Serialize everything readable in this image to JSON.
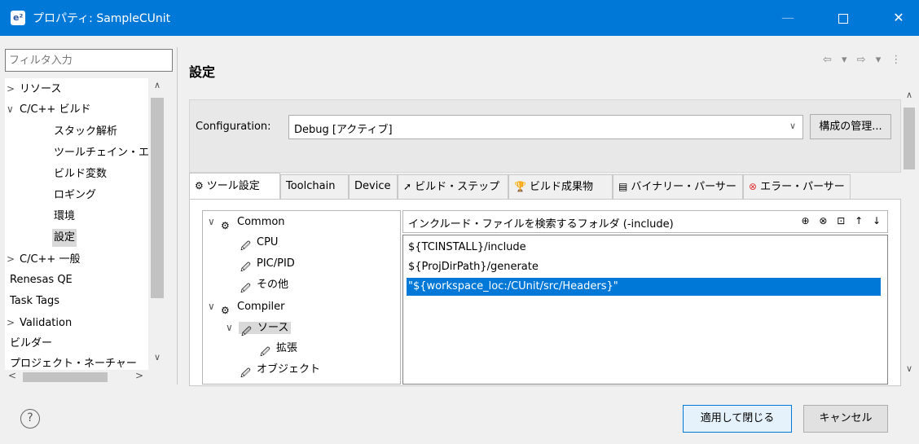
{
  "window": {
    "title": "プロパティ: SampleCUnit",
    "min_glyph": "—",
    "close_glyph": "✕"
  },
  "left": {
    "filter_placeholder": "フィルタ入力",
    "items": [
      {
        "label": "リソース",
        "chevron": ">"
      },
      {
        "label": "C/C++ ビルド",
        "chevron": "∨"
      },
      {
        "label": "スタック解析",
        "chevron": ""
      },
      {
        "label": "ツールチェイン・エデ",
        "chevron": ""
      },
      {
        "label": "ビルド変数",
        "chevron": ""
      },
      {
        "label": "ロギング",
        "chevron": ""
      },
      {
        "label": "環境",
        "chevron": ""
      },
      {
        "label": "設定",
        "chevron": ""
      },
      {
        "label": "C/C++ 一般",
        "chevron": ">"
      },
      {
        "label": "Renesas QE",
        "chevron": ""
      },
      {
        "label": "Task Tags",
        "chevron": ""
      },
      {
        "label": "Validation",
        "chevron": ">"
      },
      {
        "label": "ビルダー",
        "chevron": ""
      },
      {
        "label": "プロジェクト・ネーチャー",
        "chevron": ""
      }
    ]
  },
  "right": {
    "title": "設定",
    "nav_arrows": "⇦ ▾ ⇨ ▾ ⋮",
    "configuration_label": "Configuration:",
    "configuration_value": "Debug  [アクティブ]",
    "manage_button": "構成の管理..."
  },
  "tabs": [
    {
      "label": "ツール設定",
      "icon": "⚙"
    },
    {
      "label": "Toolchain",
      "icon": ""
    },
    {
      "label": "Device",
      "icon": ""
    },
    {
      "label": "ビルド・ステップ",
      "icon": "➚"
    },
    {
      "label": "ビルド成果物",
      "icon": "🏆"
    },
    {
      "label": "バイナリー・パーサー",
      "icon": "▤"
    },
    {
      "label": "エラー・パーサー",
      "icon": "⊗"
    }
  ],
  "tool_tree": [
    {
      "label": "Common",
      "chevron": "∨"
    },
    {
      "label": "CPU",
      "chevron": ""
    },
    {
      "label": "PIC/PID",
      "chevron": ""
    },
    {
      "label": "その他",
      "chevron": ""
    },
    {
      "label": "Compiler",
      "chevron": "∨"
    },
    {
      "label": "ソース",
      "chevron": "∨"
    },
    {
      "label": "拡張",
      "chevron": ""
    },
    {
      "label": "オブジェクト",
      "chevron": ""
    }
  ],
  "include": {
    "header": "インクルード・ファイルを検索するフォルダ (-include)",
    "tool_glyphs": "⊕ ⊗ ⊡ ↑ ↓",
    "rows": [
      "${TCINSTALL}/include",
      "${ProjDirPath}/generate",
      "\"${workspace_loc:/CUnit/src/Headers}\""
    ]
  },
  "buttons": {
    "help": "?",
    "apply_close": "適用して閉じる",
    "cancel": "キャンセル"
  },
  "colors": {
    "titlebar": "#0078d7",
    "selection": "#0078d7"
  }
}
